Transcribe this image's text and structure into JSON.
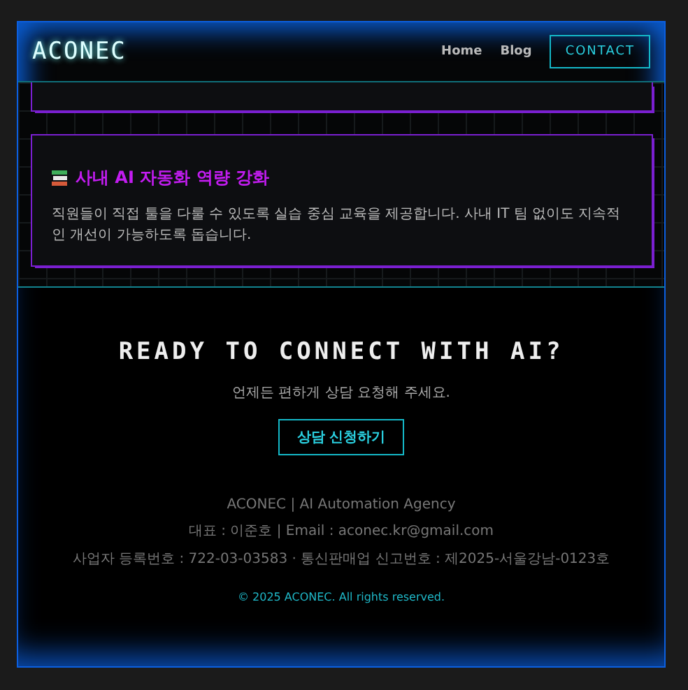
{
  "header": {
    "logo": "ACONEC",
    "nav": [
      "Home",
      "Blog"
    ],
    "cta": "CONTACT"
  },
  "cards": [
    {
      "kind": "cut"
    },
    {
      "kind": "full",
      "title": "사내 AI 자동화 역량 강화",
      "description": "직원들이 직접 툴을 다룰 수 있도록 실습 중심 교육을 제공합니다. 사내 IT 팀 없이도 지속적인 개선이 가능하도록 돕습니다."
    }
  ],
  "cta_section": {
    "title": "READY TO CONNECT WITH AI?",
    "subtitle": "언제든 편하게 상담 요청해 주세요.",
    "button": "상담 신청하기"
  },
  "footer": {
    "lines": [
      "ACONEC | AI Automation Agency",
      "대표 : 이준호 | Email : aconec.kr@gmail.com",
      "사업자 등록번호 : 722-03-03583 · 통신판매업 신고번호 : 제2025-서울강남-0123호"
    ],
    "copyright": "© 2025 ACONEC. All rights reserved."
  }
}
